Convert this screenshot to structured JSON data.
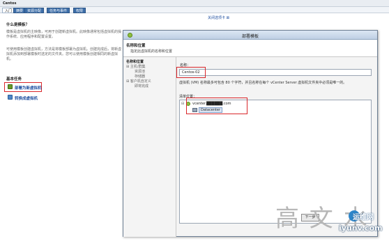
{
  "window": {
    "title": "Centos"
  },
  "tabs": [
    {
      "label": "入门",
      "active": true
    },
    {
      "label": "摘要",
      "active": false
    },
    {
      "label": "资源分配",
      "active": false
    },
    {
      "label": "任务与事件",
      "active": false
    },
    {
      "label": "权限",
      "active": false
    }
  ],
  "close_tab_label": "关闭选项卡 ⊠",
  "left": {
    "question": "什么是模板？",
    "para1": "模板是虚拟机的主映像，可用于创建新虚拟机。此映像通常包括虚拟机的操作系统、应用程序和配置设置。",
    "para2": "可使用模板创建虚拟机，方法是将模板部署为虚拟机。创建完成后，将新虚拟机添加到部署模板时选定的文件夹。您可以使用模板创建相同的新虚拟机。",
    "tasks_heading": "基本任务",
    "tasks": [
      {
        "label": "部署为新虚拟机",
        "icon": "deploy-vm-icon"
      },
      {
        "label": "转换成虚拟机",
        "icon": "convert-vm-icon"
      }
    ]
  },
  "dialog": {
    "title": "部署模板",
    "header_title": "名称和位置",
    "header_desc": "指定此虚拟机的名称和位置",
    "steps": [
      {
        "label": "名称和位置",
        "current": true
      },
      {
        "label": "⊞ 主机/群集",
        "current": false
      },
      {
        "label": "资源池",
        "current": false
      },
      {
        "label": "存储器",
        "current": false
      },
      {
        "label": "⊞ 客户机自定义",
        "current": false
      },
      {
        "label": "即将完成",
        "current": false
      }
    ],
    "name_label": "名称：",
    "name_value": "Centos-02",
    "name_hint": "虚拟机 (VM) 名称最多可包含 80 个字符，并且名称在每个 vCenter Server 虚拟机文件夹中必须是唯一的。",
    "inventory_label": "清单位置：",
    "tree": [
      {
        "label": "vcenter.██████.com",
        "icon": "vcenter-icon",
        "toggle": "⊟"
      },
      {
        "label": "Datacenter",
        "icon": "datacenter-icon"
      }
    ],
    "next_button": "下一步"
  },
  "watermarks": {
    "cn": "高 文 水",
    "brand": "运维网",
    "url": "iyunv.com"
  }
}
